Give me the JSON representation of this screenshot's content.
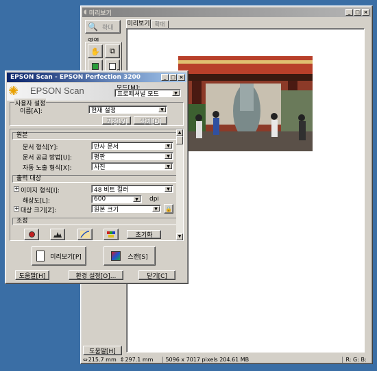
{
  "preview_window": {
    "title": "미리보기",
    "zoom_button": "확대",
    "area_label": "영역",
    "marquee_count": "0",
    "tabs": [
      {
        "label": "미리보기"
      },
      {
        "label": "확대"
      }
    ],
    "help_button": "도움말[H]",
    "status": {
      "width": "215.7 mm",
      "height": "297.1 mm",
      "pixels": "5096 x 7017 pixels 204.61 MB",
      "rgb": "R: G: B:"
    }
  },
  "scan_window": {
    "title": "EPSON Scan - EPSON Perfection 3200",
    "logo": "EPSON Scan",
    "mode_label": "모드[M]:",
    "mode_value": "프로페셔널 모드",
    "settings_section": "사용자 설정",
    "name_label": "이름[A]:",
    "name_value": "현재 설정",
    "save_button": "저장[V]",
    "delete_button": "삭제[D]",
    "original_section": "원본",
    "doc_type_label": "문서 형식[Y]:",
    "doc_type_value": "반사 문서",
    "doc_source_label": "문서 공급 방법[U]:",
    "doc_source_value": "평판",
    "auto_exposure_label": "자동 노출 형식[X]:",
    "auto_exposure_value": "사진",
    "output_section": "출력 대상",
    "image_type_label": "이미지 형식[I]:",
    "image_type_value": "48 비트 컬러",
    "resolution_label": "해상도[L]:",
    "resolution_value": "600",
    "resolution_unit": "dpi",
    "target_size_label": "대상 크기[Z]:",
    "target_size_value": "원본 크기",
    "adjust_section": "조정",
    "reset_button": "초기화",
    "preview_button": "미리보기[P]",
    "scan_button": "스캔[S]",
    "help_button": "도움말[H]",
    "config_button": "환경 설정[O]...",
    "close_button": "닫기[C]"
  }
}
